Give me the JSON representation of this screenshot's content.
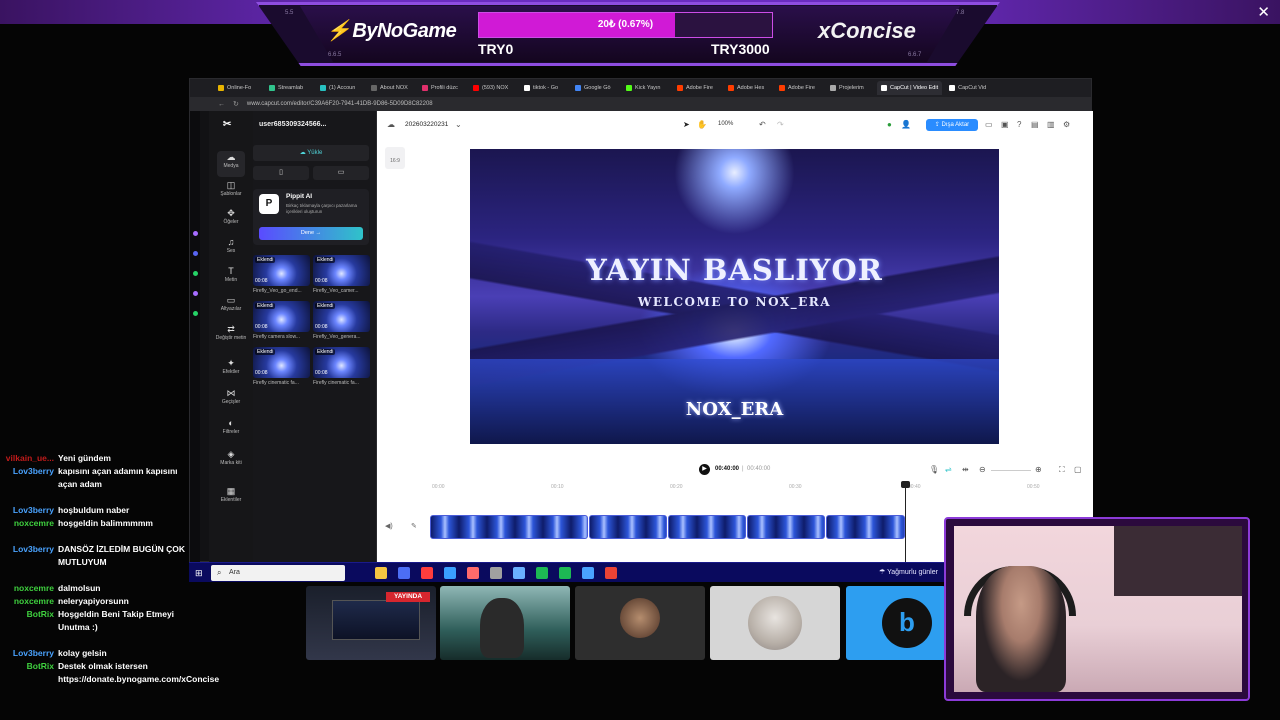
{
  "banner": {
    "brand_left": "ByNoGame",
    "brand_right": "xConcise",
    "progress_text": "20₺ (0.67%)",
    "progress_fraction": 0.067,
    "goal_min": "TRY0",
    "goal_max": "TRY3000",
    "close": "✕",
    "deco_nums": [
      "5.5",
      "7.8",
      "6.6.5",
      "6.6.7"
    ]
  },
  "browser": {
    "tabs": [
      {
        "label": "Online-Fo",
        "color": "#e8b400"
      },
      {
        "label": "Streamlab",
        "color": "#31c48d"
      },
      {
        "label": "(1) Accoun",
        "color": "#27c0c0"
      },
      {
        "label": "About NOX",
        "color": "#666"
      },
      {
        "label": "Profili düzc",
        "color": "#e1306c"
      },
      {
        "label": "(593) NOX",
        "color": "#ff0000"
      },
      {
        "label": "tiktok - Go",
        "color": "#ffffff"
      },
      {
        "label": "Google Gö",
        "color": "#4285f4"
      },
      {
        "label": "Kick Yayın",
        "color": "#53fc18"
      },
      {
        "label": "Adobe Fire",
        "color": "#ff3d00"
      },
      {
        "label": "Adobe Hes",
        "color": "#ff3d00"
      },
      {
        "label": "Adobe Fire",
        "color": "#ff3d00"
      },
      {
        "label": "Projelerim",
        "color": "#aaaaaa"
      },
      {
        "label": "CapCut | Video Edit",
        "color": "#ffffff",
        "active": true
      },
      {
        "label": "CapCut Vid",
        "color": "#ffffff"
      }
    ],
    "url": "www.capcut.com/editor/C39A6F20-7941-41DB-9D86-5D09D8C82208"
  },
  "capcut": {
    "username": "user685309324566...",
    "sidebar": [
      {
        "label": "Medya",
        "icon": "☁"
      },
      {
        "label": "Şablonlar",
        "icon": "◫"
      },
      {
        "label": "Öğeler",
        "icon": "✥"
      },
      {
        "label": "Ses",
        "icon": "♫"
      },
      {
        "label": "Metin",
        "icon": "T"
      },
      {
        "label": "Altyazılar",
        "icon": "▭"
      },
      {
        "label": "Değiştir metin",
        "icon": "⇄"
      },
      {
        "label": "Efektler",
        "icon": "✦"
      },
      {
        "label": "Geçişler",
        "icon": "⋈"
      },
      {
        "label": "Filtreler",
        "icon": "◐"
      },
      {
        "label": "Marka kiti",
        "icon": "◈"
      },
      {
        "label": "Eklentiler",
        "icon": "▦"
      }
    ],
    "upload_label": "Yükle",
    "pippit": {
      "title": "Pippit AI",
      "desc": "Birkaç tıklamayla çarpıcı pazarlama içerikleri oluşturun",
      "button": "Dene →"
    },
    "media": [
      {
        "tag": "Eklendi",
        "duration": "00:08",
        "label": "Firefly_Veo_go_end..."
      },
      {
        "tag": "Eklendi",
        "duration": "00:08",
        "label": "Firefly_Veo_camer..."
      },
      {
        "tag": "Eklendi",
        "duration": "00:08",
        "label": "Firefly camera slow..."
      },
      {
        "tag": "Eklendi",
        "duration": "00:08",
        "label": "Firefly_Veo_genera..."
      },
      {
        "tag": "Eklendi",
        "duration": "00:08",
        "label": "Firefly cinematic fa..."
      },
      {
        "tag": "Eklendi",
        "duration": "00:08",
        "label": "Firefly cinematic fa..."
      }
    ],
    "project_name": "202603220231",
    "zoom": "100%",
    "export_label": "Dışa Aktar",
    "ratio": "16:9",
    "preview": {
      "title": "YAYIN BASLIYOR",
      "subtitle": "WELCOME TO NOX_ERA",
      "brand": "NOX_ERA"
    },
    "time_current": "00:40:00",
    "time_total": "00:40:00",
    "ruler": [
      "00:00",
      "00:10",
      "00:20",
      "00:30",
      "00:40",
      "00:50"
    ],
    "clip_widths": [
      190,
      93,
      93,
      93,
      95
    ],
    "playhead_fraction": 0.8
  },
  "taskbar": {
    "search_placeholder": "Ara",
    "apps": [
      "#f5c542",
      "#4c6ef5",
      "#ff3d3d",
      "#3aa0ff",
      "#ff6b6b",
      "#a0a0a0",
      "#6ab0ff",
      "#1db954",
      "#1db954",
      "#4aa3ff",
      "#ea4335"
    ],
    "weather": "Yağmurlu günler"
  },
  "chat": [
    {
      "user": "vilkain_ue...",
      "color": "#c21b1b",
      "text": "Yeni gündem"
    },
    {
      "user": "Lov3berry",
      "color": "#4aa3ff",
      "text": "kapısını açan adamın kapısını açan adam"
    },
    {
      "user": "Lov3berry",
      "color": "#4aa3ff",
      "text": "hoşbuldum naber"
    },
    {
      "user": "noxcemre",
      "color": "#3fd13f",
      "text": "hoşgeldin balimmmmm"
    },
    {
      "user": "Lov3berry",
      "color": "#4aa3ff",
      "text": "DANSÖZ İZLEDİM BUGÜN ÇOK MUTLUYUM"
    },
    {
      "user": "noxcemre",
      "color": "#3fd13f",
      "text": "dalmolsun"
    },
    {
      "user": "noxcemre",
      "color": "#3fd13f",
      "text": "neleryapiyorsunn"
    },
    {
      "user": "BotRix",
      "color": "#3fd13f",
      "text": "Hoşgeldin Beni Takip Etmeyi Unutma :)"
    },
    {
      "user": "Lov3berry",
      "color": "#4aa3ff",
      "text": "kolay gelsin"
    },
    {
      "user": "BotRix",
      "color": "#3fd13f",
      "text": "Destek olmak istersen https://donate.bynogame.com/xConcise"
    }
  ],
  "cams": {
    "live_badge": "YAYINDA"
  }
}
